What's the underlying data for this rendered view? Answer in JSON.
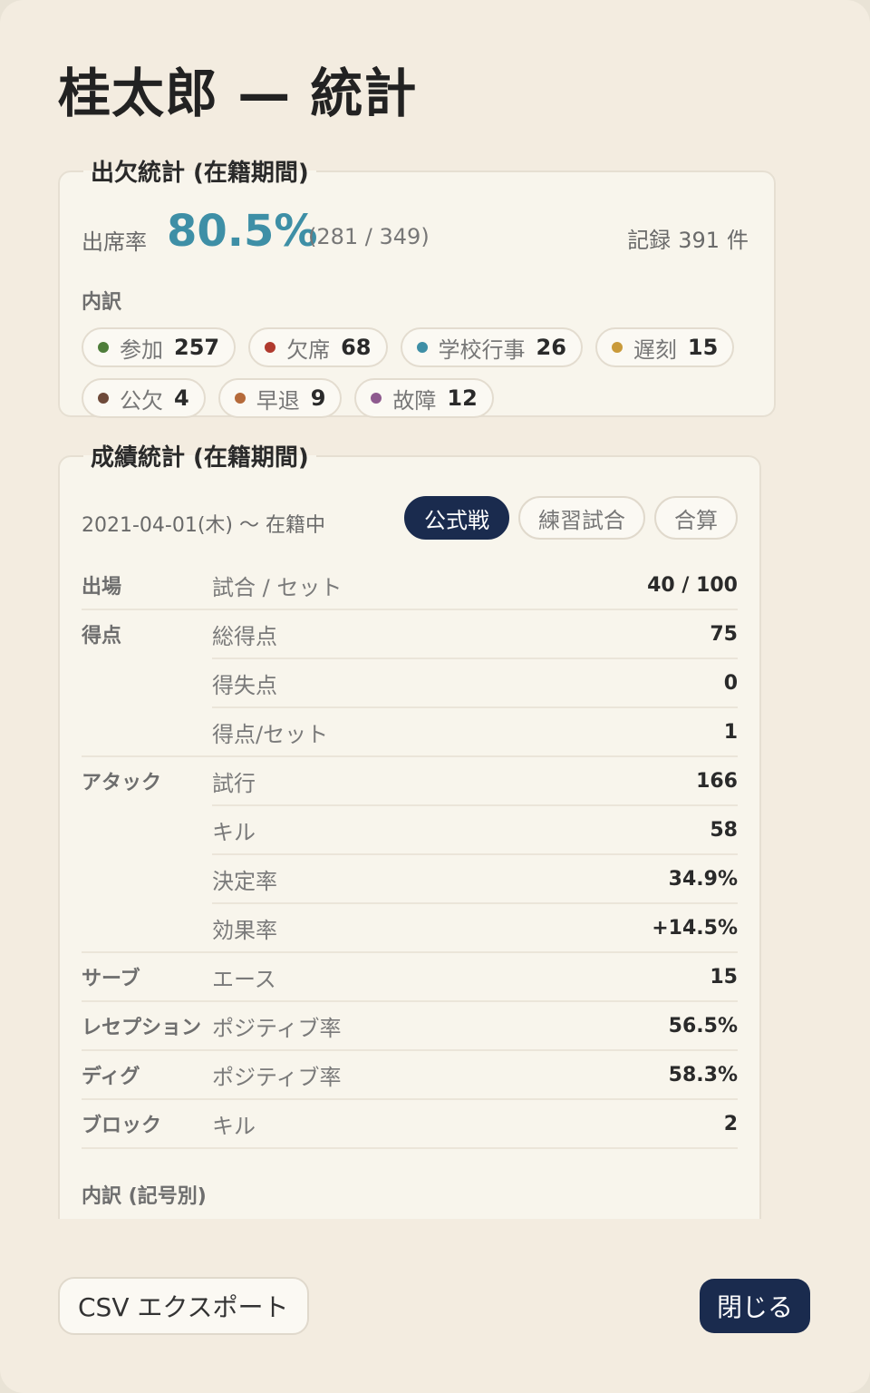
{
  "title": "桂太郎 — 統計",
  "attendance": {
    "legend": "出欠統計 (在籍期間)",
    "rate_label": "出席率",
    "rate_value": "80.5%",
    "rate_detail": "(281 / 349)",
    "records_prefix": "記録",
    "records_count": "391",
    "records_suffix": "件",
    "breakdown_label": "内訳",
    "chips": [
      {
        "label": "参加",
        "count": "257",
        "color": "#4e7d3a"
      },
      {
        "label": "欠席",
        "count": "68",
        "color": "#b03a2e"
      },
      {
        "label": "学校行事",
        "count": "26",
        "color": "#3e8fa6"
      },
      {
        "label": "遅刻",
        "count": "15",
        "color": "#c99a3a"
      },
      {
        "label": "公欠",
        "count": "4",
        "color": "#6e4a3a"
      },
      {
        "label": "早退",
        "count": "9",
        "color": "#b56a3a"
      },
      {
        "label": "故障",
        "count": "12",
        "color": "#8e5a8e"
      }
    ]
  },
  "stats": {
    "legend": "成績統計 (在籍期間)",
    "period": "2021-04-01(木) 〜 在籍中",
    "segments": [
      {
        "label": "公式戦",
        "active": true
      },
      {
        "label": "練習試合",
        "active": false
      },
      {
        "label": "合算",
        "active": false
      }
    ],
    "groups": [
      {
        "category": "出場",
        "rows": [
          {
            "label": "試合 / セット",
            "value": "40 / 100"
          }
        ]
      },
      {
        "category": "得点",
        "rows": [
          {
            "label": "総得点",
            "value": "75"
          },
          {
            "label": "得失点",
            "value": "0"
          },
          {
            "label": "得点/セット",
            "value": "1"
          }
        ]
      },
      {
        "category": "アタック",
        "rows": [
          {
            "label": "試行",
            "value": "166"
          },
          {
            "label": "キル",
            "value": "58"
          },
          {
            "label": "決定率",
            "value": "34.9%"
          },
          {
            "label": "効果率",
            "value": "+14.5%"
          }
        ]
      },
      {
        "category": "サーブ",
        "rows": [
          {
            "label": "エース",
            "value": "15"
          }
        ]
      },
      {
        "category": "レセプション",
        "rows": [
          {
            "label": "ポジティブ率",
            "value": "56.5%"
          }
        ]
      },
      {
        "category": "ディグ",
        "rows": [
          {
            "label": "ポジティブ率",
            "value": "58.3%"
          }
        ]
      },
      {
        "category": "ブロック",
        "rows": [
          {
            "label": "キル",
            "value": "2"
          }
        ]
      }
    ],
    "breakdown_title": "内訳 (記号別)"
  },
  "footer": {
    "csv_label": "CSV エクスポート",
    "close_label": "閉じる"
  }
}
